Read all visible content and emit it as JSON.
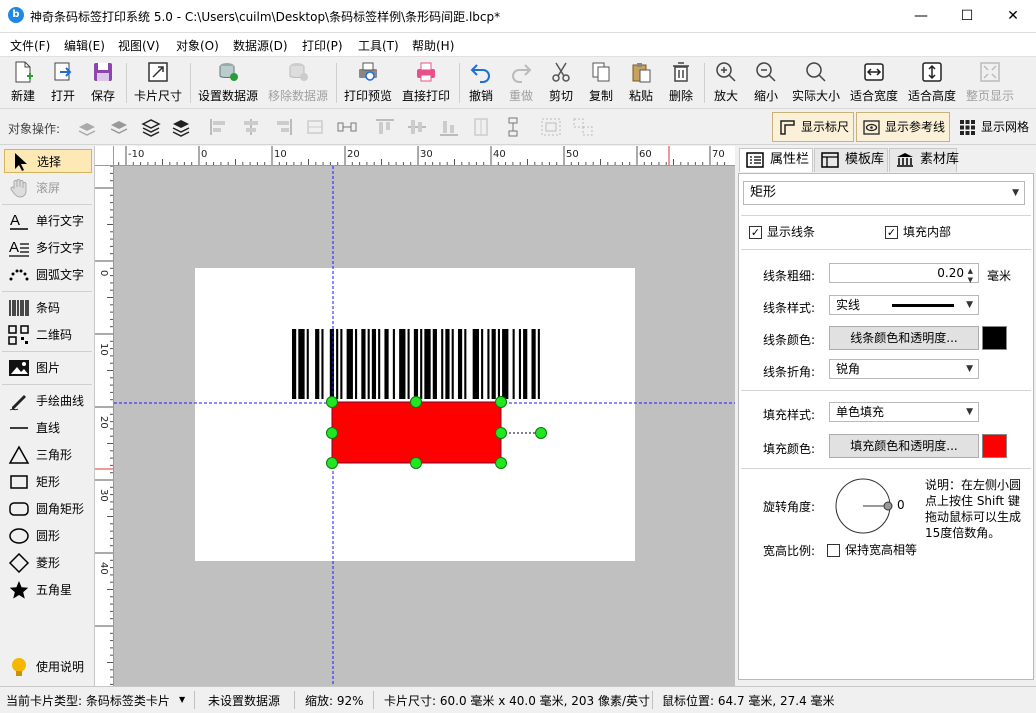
{
  "window": {
    "title": "神奇条码标签打印系统 5.0 - C:\\Users\\cuilm\\Desktop\\条码标签样例\\条形码间距.lbcp*"
  },
  "menu": [
    "文件(F)",
    "编辑(E)",
    "视图(V)",
    "对象(O)",
    "数据源(D)",
    "打印(P)",
    "工具(T)",
    "帮助(H)"
  ],
  "toolbar": {
    "new": "新建",
    "open": "打开",
    "save": "保存",
    "card_size": "卡片尺寸",
    "set_datasource": "设置数据源",
    "remove_datasource": "移除数据源",
    "print_preview": "打印预览",
    "direct_print": "直接打印",
    "undo": "撤销",
    "redo": "重做",
    "cut": "剪切",
    "copy": "复制",
    "paste": "粘贴",
    "delete": "删除",
    "zoom_in": "放大",
    "zoom_out": "缩小",
    "actual_size": "实际大小",
    "fit_width": "适合宽度",
    "fit_height": "适合高度",
    "fit_page": "整页显示"
  },
  "objbar": {
    "label": "对象操作:",
    "show_ruler": "显示标尺",
    "show_guides": "显示参考线",
    "show_grid": "显示网格"
  },
  "tools": {
    "select": "选择",
    "scroll": "滚屏",
    "single_text": "单行文字",
    "multi_text": "多行文字",
    "arc_text": "圆弧文字",
    "barcode": "条码",
    "qrcode": "二维码",
    "image": "图片",
    "freehand": "手绘曲线",
    "line": "直线",
    "triangle": "三角形",
    "rectangle": "矩形",
    "round_rect": "圆角矩形",
    "ellipse": "圆形",
    "diamond": "菱形",
    "star": "五角星",
    "help": "使用说明"
  },
  "ruler": {
    "h_labels": [
      "-10",
      "0",
      "10",
      "20",
      "30",
      "40",
      "50",
      "60",
      "70"
    ],
    "v_labels": [
      "0",
      "10",
      "20",
      "30",
      "40"
    ]
  },
  "panel": {
    "tabs": [
      "属性栏",
      "模板库",
      "素材库"
    ],
    "object_type": "矩形",
    "show_line": "显示线条",
    "fill_inside": "填充内部",
    "line_width_label": "线条粗细:",
    "line_width_value": "0.20",
    "line_width_unit": "毫米",
    "line_style_label": "线条样式:",
    "line_style_value": "实线",
    "line_color_label": "线条颜色:",
    "line_color_button": "线条颜色和透明度...",
    "line_color": "#000000",
    "line_join_label": "线条折角:",
    "line_join_value": "锐角",
    "fill_style_label": "填充样式:",
    "fill_style_value": "单色填充",
    "fill_color_label": "填充颜色:",
    "fill_color_button": "填充颜色和透明度...",
    "fill_color": "#ff0000",
    "rotation_label": "旋转角度:",
    "rotation_value": "0",
    "rotation_note_1": "说明：在左侧小圆",
    "rotation_note_2": "点上按住 Shift 键",
    "rotation_note_3": "拖动鼠标可以生成",
    "rotation_note_4": "15度倍数角。",
    "aspect_label": "宽高比例:",
    "aspect_keep": "保持宽高相等"
  },
  "status": {
    "card_type": "当前卡片类型: 条码标签类卡片",
    "datasource": "未设置数据源",
    "zoom": "缩放: 92%",
    "card_size": "卡片尺寸: 60.0 毫米 x 40.0 毫米, 203 像素/英寸",
    "mouse_pos": "鼠标位置: 64.7 毫米, 27.4 毫米"
  },
  "barcode_bars": [
    2,
    1,
    3,
    1,
    1,
    3,
    2,
    1,
    1,
    3,
    2,
    1,
    1,
    1,
    1,
    2,
    3,
    1,
    1,
    2,
    2,
    1,
    1,
    1,
    2,
    1,
    1,
    2,
    2,
    2,
    1,
    2,
    3,
    1,
    1,
    2,
    2,
    1,
    1,
    1,
    3,
    1,
    2,
    2,
    1,
    1,
    2,
    1,
    1,
    2,
    2,
    1,
    1,
    3,
    3,
    1,
    1,
    2,
    1,
    1,
    2,
    1,
    1,
    1,
    3,
    2,
    1,
    2,
    1,
    1,
    2,
    2,
    2,
    1,
    1,
    1
  ]
}
